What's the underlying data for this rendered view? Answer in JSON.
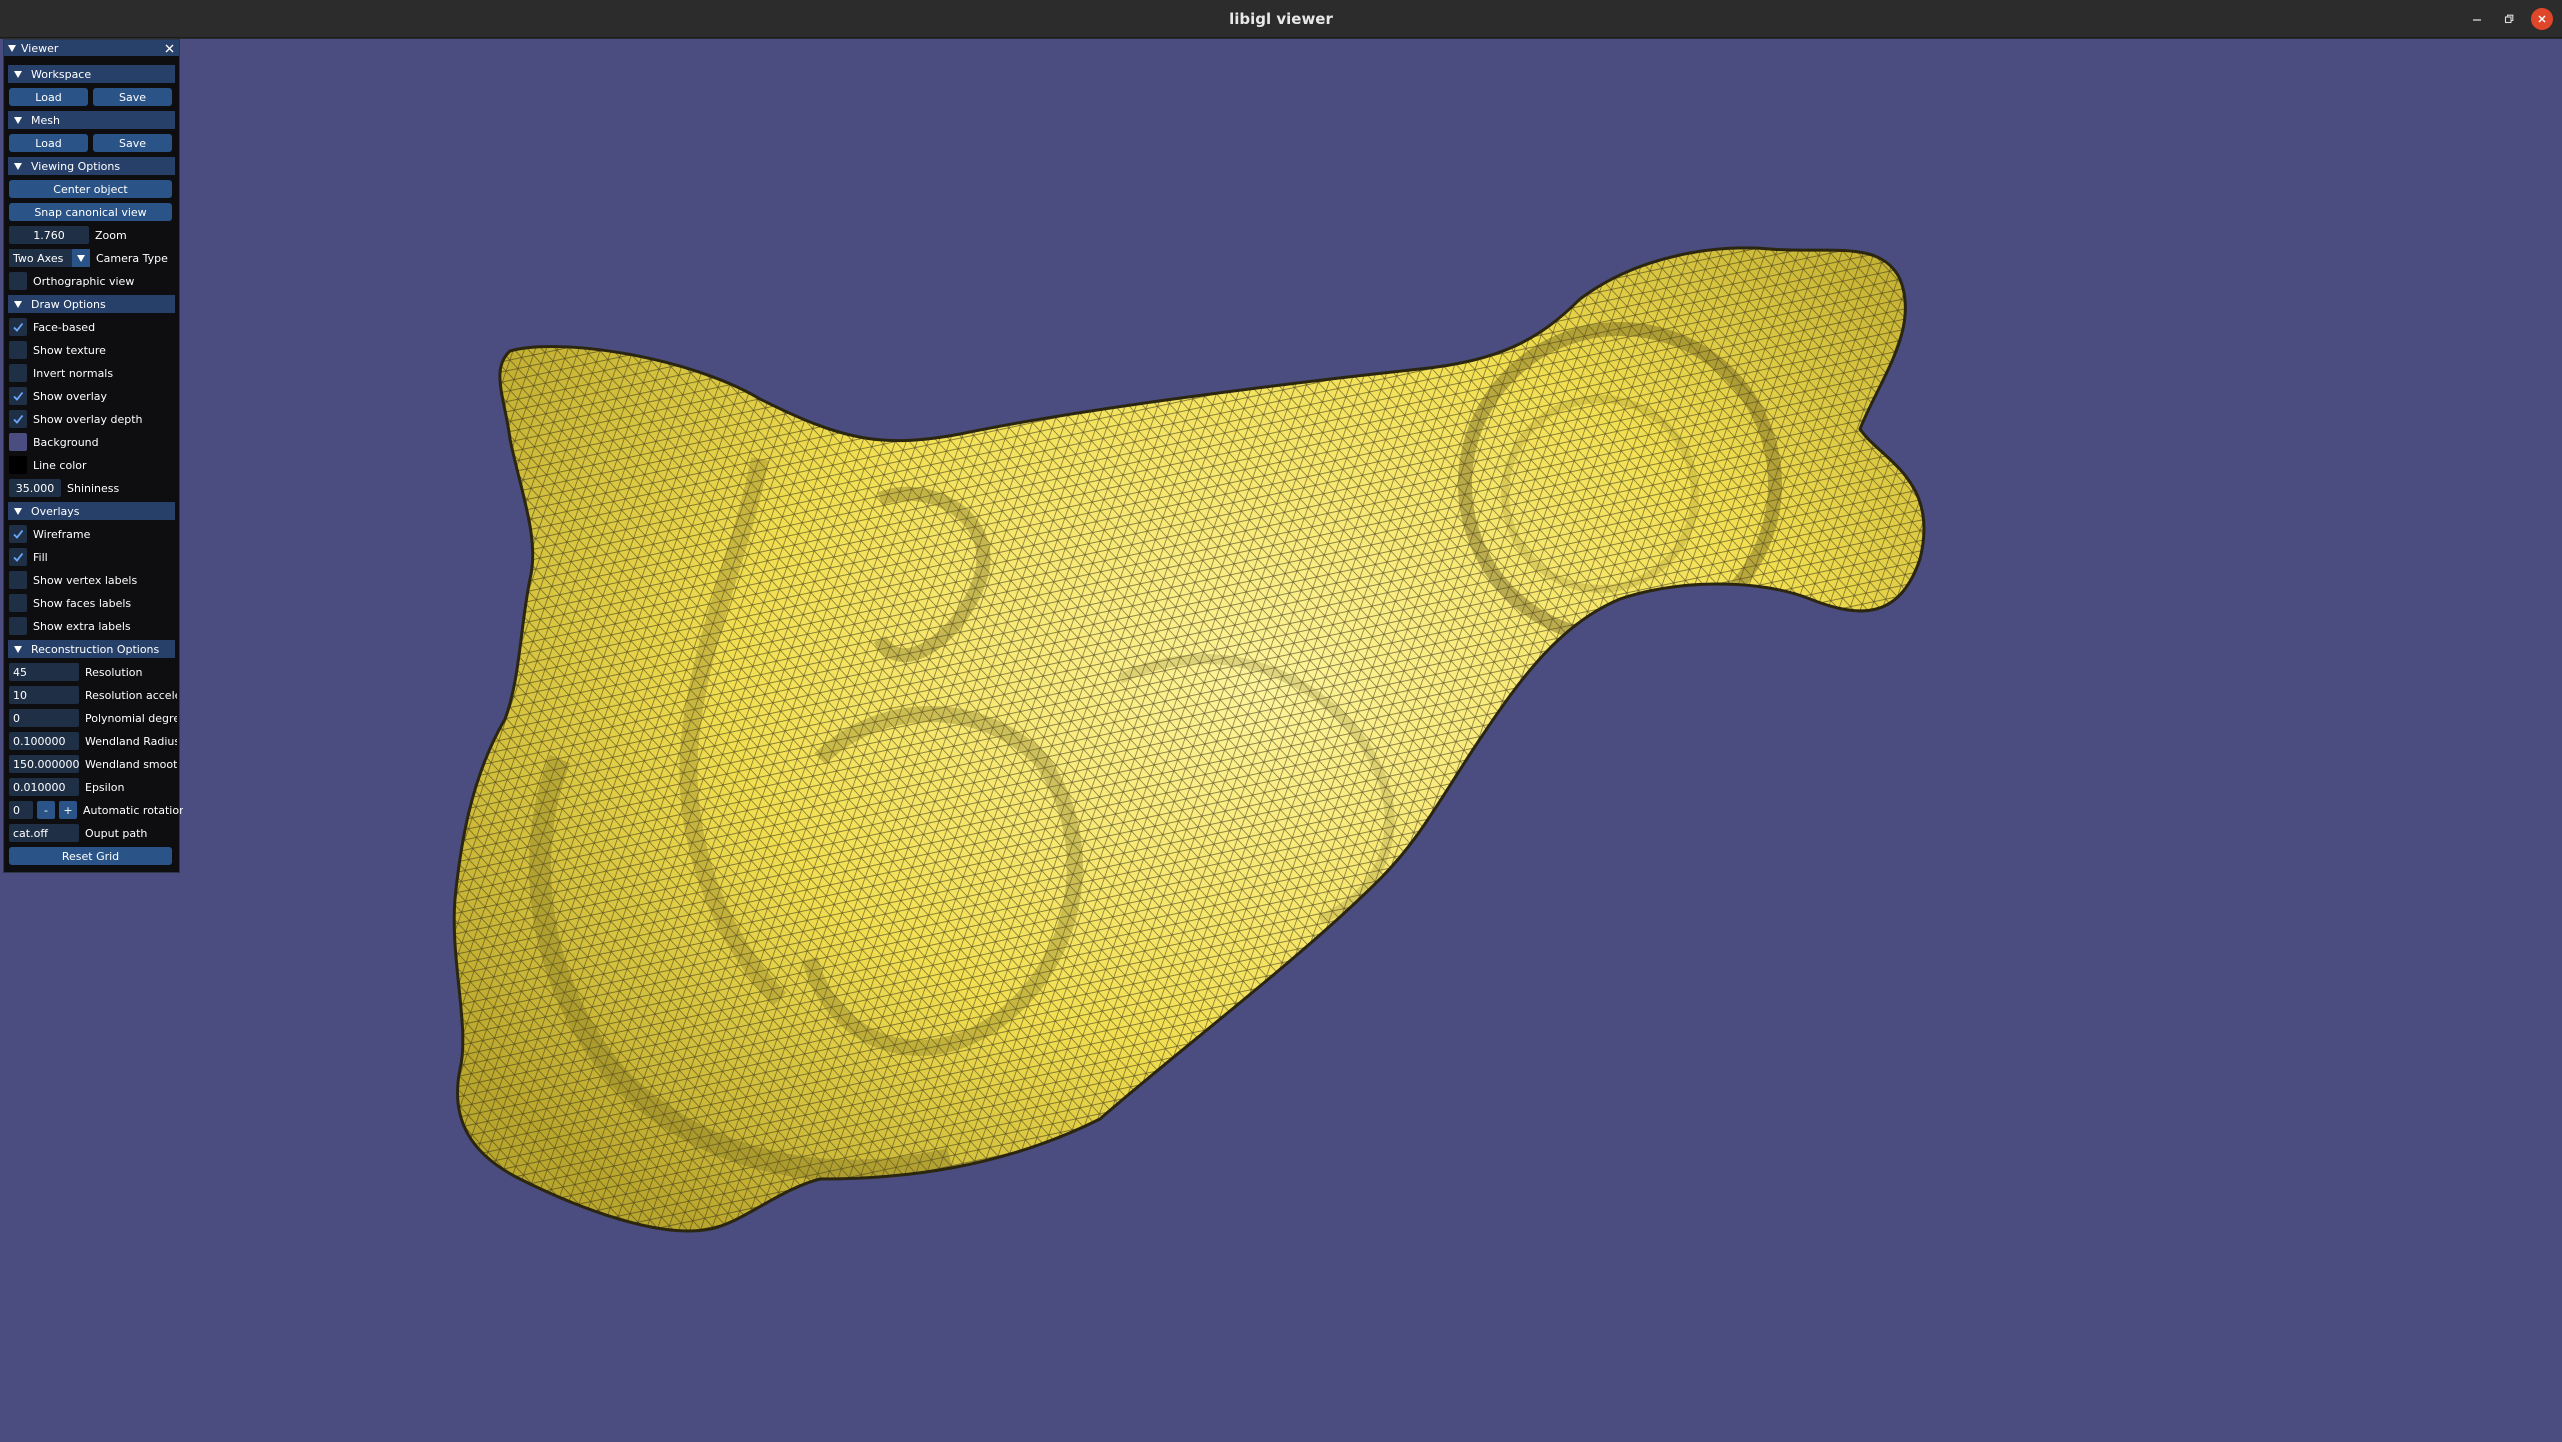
{
  "window": {
    "title": "libigl viewer",
    "minimize_icon": "minimize-icon",
    "maximize_icon": "restore-icon",
    "close_icon": "close-icon"
  },
  "colors": {
    "background": "#4b4c7f",
    "mesh_fill": "#f2e15a",
    "line_color": "#000000",
    "panel_header": "#26406a",
    "button": "#2a5488",
    "close_button": "#e0462a"
  },
  "panel": {
    "title": "Viewer",
    "workspace": {
      "header": "Workspace",
      "load": "Load",
      "save": "Save"
    },
    "mesh": {
      "header": "Mesh",
      "load": "Load",
      "save": "Save"
    },
    "viewing": {
      "header": "Viewing Options",
      "center_object": "Center object",
      "snap_view": "Snap canonical view",
      "zoom_value": "1.760",
      "zoom_label": "Zoom",
      "camera_value": "Two Axes",
      "camera_label": "Camera Type",
      "ortho_label": "Orthographic view",
      "ortho_checked": false
    },
    "draw": {
      "header": "Draw Options",
      "items": [
        {
          "label": "Face-based",
          "checked": true
        },
        {
          "label": "Show texture",
          "checked": false
        },
        {
          "label": "Invert normals",
          "checked": false
        },
        {
          "label": "Show overlay",
          "checked": true
        },
        {
          "label": "Show overlay depth",
          "checked": true
        }
      ],
      "background_label": "Background",
      "background_color": "#4b4c7f",
      "line_color_label": "Line color",
      "line_color_value": "#000000",
      "shininess_value": "35.000",
      "shininess_label": "Shininess"
    },
    "overlays": {
      "header": "Overlays",
      "items": [
        {
          "label": "Wireframe",
          "checked": true
        },
        {
          "label": "Fill",
          "checked": true
        },
        {
          "label": "Show vertex labels",
          "checked": false
        },
        {
          "label": "Show faces labels",
          "checked": false
        },
        {
          "label": "Show extra labels",
          "checked": false
        }
      ]
    },
    "reconstruction": {
      "header": "Reconstruction Options",
      "fields": [
        {
          "value": "45",
          "label": "Resolution"
        },
        {
          "value": "10",
          "label": "Resolution acceler"
        },
        {
          "value": "0",
          "label": "Polynomial degree"
        },
        {
          "value": "0.100000",
          "label": "Wendland Radius"
        },
        {
          "value": "150.000000",
          "label": "Wendland smooth"
        },
        {
          "value": "0.010000",
          "label": "Epsilon"
        }
      ],
      "rotation_value": "0",
      "rotation_minus": "-",
      "rotation_plus": "+",
      "rotation_label": "Automatic rotation",
      "output_value": "cat.off",
      "output_label": "Ouput path",
      "reset_grid": "Reset Grid"
    }
  }
}
